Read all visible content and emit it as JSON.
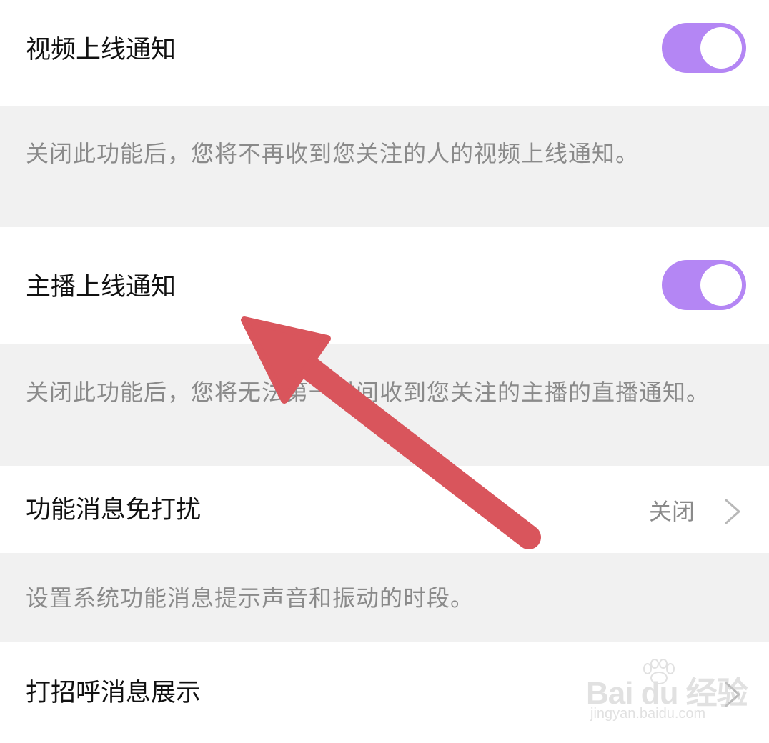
{
  "settings": {
    "video_online": {
      "label": "视频上线通知",
      "enabled": true,
      "description": "关闭此功能后，您将不再收到您关注的人的视频上线通知。"
    },
    "streamer_online": {
      "label": "主播上线通知",
      "enabled": true,
      "description": "关闭此功能后，您将无法第一时间收到您关注的主播的直播通知。"
    },
    "feature_dnd": {
      "label": "功能消息免打扰",
      "value": "关闭",
      "description": "设置系统功能消息提示声音和振动的时段。"
    },
    "greeting_display": {
      "label": "打招呼消息展示"
    }
  },
  "icons": {
    "toggle": "toggle-switch",
    "chevron": "chevron-right-icon",
    "annotation": "red-arrow"
  },
  "colors": {
    "toggle_on": "#b486f4",
    "section_bg": "#f1f1f1",
    "arrow": "#d9555c"
  },
  "watermark": {
    "brand": "Bai du 经验",
    "url": "jingyan.baidu.com"
  }
}
